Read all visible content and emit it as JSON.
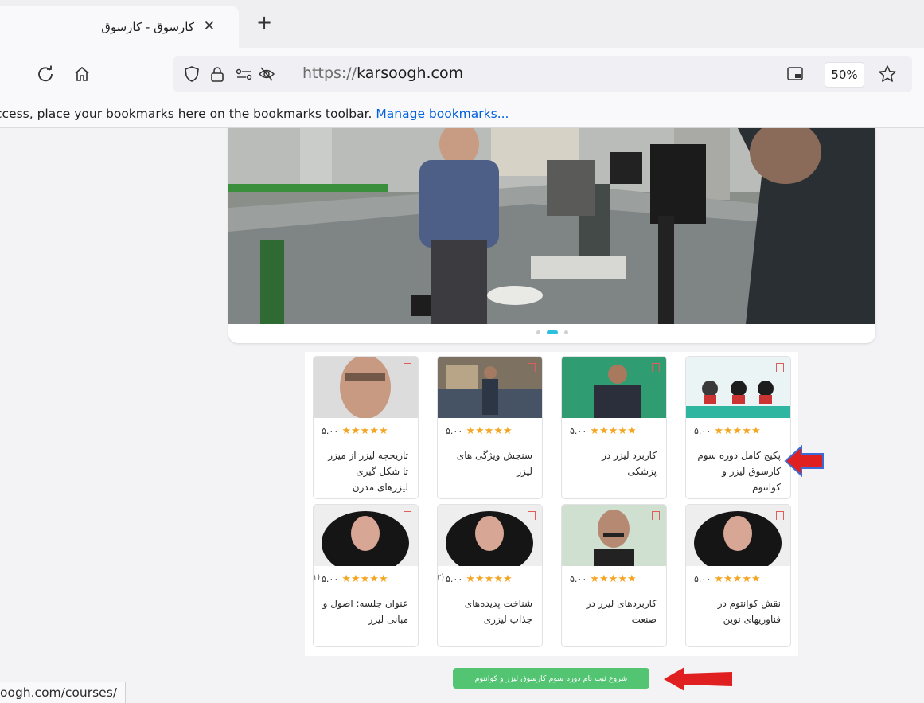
{
  "tab": {
    "title": "کارسوق - کارسوق",
    "close_glyph": "✕",
    "new_tab_glyph": "+"
  },
  "toolbar": {
    "url_scheme": "https://",
    "url_host": "karsoogh.com",
    "zoom": "50%",
    "icons": [
      "reload-icon",
      "home-icon",
      "shield-icon",
      "lock-icon",
      "permissions-icon",
      "tracking-off-icon",
      "reader-view-icon",
      "bookmark-star-icon"
    ]
  },
  "bookmarks_bar": {
    "message": "ccess, place your bookmarks here on the bookmarks toolbar. ",
    "link": "Manage bookmarks..."
  },
  "slider": {
    "dots": 3,
    "active_dot": 2
  },
  "courses": [
    {
      "title": "پکیج کامل دوره سوم کارسوق لیزر و کوانتوم",
      "rating": "۵.۰۰",
      "count": "",
      "stars": 5,
      "thumb": "banner"
    },
    {
      "title": "کاربرد لیزر در پزشکی",
      "rating": "۵.۰۰",
      "count": "",
      "stars": 5,
      "thumb": "man-suit-green"
    },
    {
      "title": "سنجش ویژگی های لیزر",
      "rating": "۵.۰۰",
      "count": "",
      "stars": 5,
      "thumb": "lab"
    },
    {
      "title": "تاریخچه لیزر از میزر تا شکل گیری لیزرهای مدرن",
      "rating": "۵.۰۰",
      "count": "",
      "stars": 5,
      "thumb": "man-closeup"
    },
    {
      "title": "نقش کوانتوم در فناوریهای نوین",
      "rating": "۵.۰۰",
      "count": "",
      "stars": 5,
      "thumb": "woman-hijab"
    },
    {
      "title": "کاربردهای لیزر در صنعت",
      "rating": "۵.۰۰",
      "count": "",
      "stars": 5,
      "thumb": "man-mustache"
    },
    {
      "title": "شناخت پدیده‌های جذاب لیزری",
      "rating": "۵.۰۰",
      "count": "(۲)",
      "stars": 5,
      "thumb": "woman-hijab"
    },
    {
      "title": "عنوان جلسه: اصول و مبانی لیزر",
      "rating": "۵.۰۰",
      "count": "(۱)",
      "stars": 5,
      "thumb": "woman-hijab"
    }
  ],
  "cta": {
    "label": "شروع ثبت نام دوره سوم کارسوق لیزر و کوانتوم"
  },
  "status_url": "oogh.com/courses/",
  "colors": {
    "accent_green": "#52c472",
    "star": "#f4a522",
    "annotation_arrow": "#e02020",
    "dot_active": "#2bc0dd"
  }
}
